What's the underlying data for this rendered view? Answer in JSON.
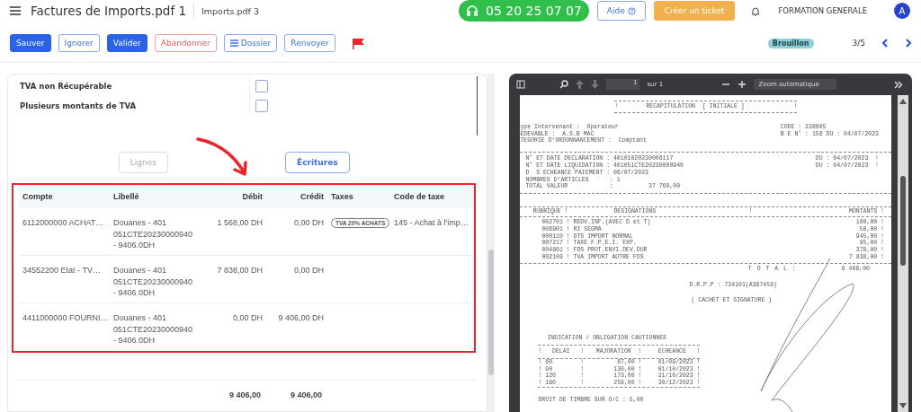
{
  "header": {
    "title": "Factures de Imports.pdf 1",
    "subtitle": "Imports.pdf 3",
    "phone": "05 20 25 07 07",
    "help": "Aide",
    "ticket": "Créer un ticket",
    "company": "FORMATION GENERALE",
    "avatar": "A"
  },
  "toolbar": {
    "buttons": [
      {
        "label": "Sauver",
        "kind": "primary",
        "has_icon": false
      },
      {
        "label": "Ignorer",
        "kind": "outline",
        "has_icon": false
      },
      {
        "label": "Valider",
        "kind": "primary",
        "has_icon": false
      },
      {
        "label": "Abandonner",
        "kind": "danger",
        "has_icon": false
      },
      {
        "label": "Dossier",
        "kind": "outline",
        "has_icon": true
      },
      {
        "label": "Renvoyer",
        "kind": "outline",
        "has_icon": false
      }
    ],
    "flagged": true,
    "status": "Brouillon",
    "pager": "3/5"
  },
  "form": {
    "fields": [
      {
        "label": "TVA non Récupérable",
        "checked": false
      },
      {
        "label": "Plusieurs montants de TVA",
        "checked": false
      }
    ]
  },
  "view_tabs": [
    {
      "label": "Lignes",
      "selected": false
    },
    {
      "label": "Écritures",
      "selected": true
    }
  ],
  "table": {
    "columns": [
      "Compte",
      "Libellé",
      "Débit",
      "Crédit",
      "Taxes",
      "Code de taxe"
    ],
    "rows": [
      {
        "compte": "6112000000 ACHAT…",
        "libelle": "Douanes - 401 051CTE20230000940 - 9406.0DH",
        "debit": "1 568,00 DH",
        "credit": "0,00 DH",
        "taxes": "TVA 20% ACHATS",
        "code_taxe": "145 - Achat à l'imp…"
      },
      {
        "compte": "34552200 Etat - TV…",
        "libelle": "Douanes - 401 051CTE20230000940 - 9406.0DH",
        "debit": "7 838,00 DH",
        "credit": "0,00 DH"
      },
      {
        "compte": "4411000000 FOURNI…",
        "libelle": "Douanes - 401 051CTE20230000940 - 9406.0DH",
        "debit": "0,00 DH",
        "credit": "9 406,00 DH"
      }
    ],
    "totals": {
      "debit": "9 406,00",
      "credit": "9 406,00"
    }
  },
  "viewer": {
    "page": "1",
    "of": "sur 1",
    "zoom": "Zoom automatique",
    "document": {
      "heading": "!        RECAPITULATION  [ INITIALE ]              !",
      "party_left": [
        "ype Intervenant :  Operateur",
        "EDEVABLE :  A.S.B MAC",
        "TEGORIE D'ORDONNANCEMENT :  Comptant"
      ],
      "party_right": [
        "CODE : 238005",
        "B E N° : 156 DU : 04/07/2023"
      ],
      "decl_left": [
        "N° ET DATE DECLARATION : 40101020230006117",
        "N° ET DATE LIQUIDATION : 401051CTE20230000940",
        "D  S ECHEANCE PAIEMENT : 06/07/2023",
        "NOMBRES D'ARTICLES      : 1",
        "TOTAL VALEUR            :          37 769,00"
      ],
      "decl_right": [
        "DU : 04/07/2023  !",
        "DU : 04/07/2023  !"
      ],
      "rub_head": [
        "RUBRIQUE  !",
        "DESIGNATIONS",
        "!",
        "MONTANTS   !"
      ],
      "rubriques": [
        {
          "code": "002701 ! REDV.INF.(AVEC D et T)",
          "amount": "100,00 !"
        },
        {
          "code": "006901 ! RI SEGMA",
          "amount": "50,00 !"
        },
        {
          "code": "000110 ! DTS IMPORT NORMAL",
          "amount": "945,00 !"
        },
        {
          "code": "007217 ! TAXE F.P.E.I. EXP.",
          "amount": "95,00 !"
        },
        {
          "code": "004801 ! FDS PROT.ENVI.DEV.DUR",
          "amount": "378,00 !"
        },
        {
          "code": "002109 ! TVA IMPORT AUTRE FDS",
          "amount": "7 838,00 !"
        }
      ],
      "total_label": "T O T A L :",
      "total": "9 406,00",
      "drpp": "D.R.P.P : 734101(A387459)",
      "cachet": "( CACHET ET SIGNATURE )",
      "caution_title": "INDICATION / OBLIGATION CAUTIONNEE",
      "caution_head": [
        "!   DELAI   !",
        "MAJORATION  !",
        "ECHEANCE   !"
      ],
      "caution": [
        {
          "delai": "! 60        !",
          "maj": "87,00 !",
          "ech": "01/09/2023 !"
        },
        {
          "delai": "! 90        !",
          "maj": "130,00 !",
          "ech": "01/10/2023 !"
        },
        {
          "delai": "! 120       !",
          "maj": "173,00 !",
          "ech": "31/10/2023 !"
        },
        {
          "delai": "! 180       !",
          "maj": "259,00 !",
          "ech": "30/12/2023 !"
        }
      ],
      "timbre": "DROIT DE TIMBRE SUR O/C : 5,00"
    }
  }
}
